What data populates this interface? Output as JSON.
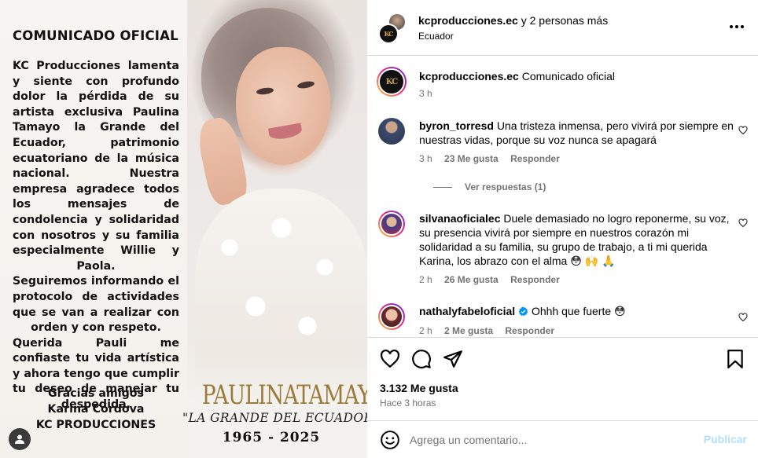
{
  "post_image": {
    "statement_title": "COMUNICADO OFICIAL",
    "statement_lead": "KC Producciones",
    "statement_p1_rest": " lamenta y siente con profundo dolor la pérdida de su artista exclusiva Paulina Tamayo la Grande del Ecuador, patrimonio ecuatoriano de la música nacional. Nuestra empresa agradece todos los mensajes de condolencia y solidaridad con nosotros y su familia especialmente Willie y Paola.",
    "statement_p2": "Seguiremos informando el protocolo de actividades que se van a realizar con orden y con respeto.",
    "statement_p3": "Querida Pauli me confiaste tu vida artística y ahora tengo que cumplir tu deseo de manejar tu despedida.",
    "signoff": [
      "Gracias amigos",
      "Karina Córdova",
      "KC PRODUCCIONES"
    ],
    "artist_name": "PAULINATAMAYO",
    "artist_tagline": "\"LA GRANDE DEL ECUADOR\"",
    "artist_years": "1965 - 2025"
  },
  "header": {
    "username": "kcproducciones.ec",
    "connector": " y 2 personas más",
    "location": "Ecuador",
    "logo_text": "KC"
  },
  "caption": {
    "username": "kcproducciones.ec",
    "text": "Comunicado oficial",
    "time": "3 h"
  },
  "comments": [
    {
      "username": "byron_torresd",
      "text": "Una tristeza inmensa, pero vivirá por siempre en nuestras vidas, porque su voz nunca se apagará",
      "time": "3 h",
      "likes": "23 Me gusta",
      "reply": "Responder",
      "replies_label": "Ver respuestas (1)",
      "verified": false
    },
    {
      "username": "silvanaoficialec",
      "text": "Duele demasiado no logro reponerme, su voz, su presencia vivirá por siempre en nuestros corazón mi solidaridad a su familia, su grupo de trabajo, a ti mi querida Karina, los abrazo con el alma 😳 🙌 🙏",
      "time": "2 h",
      "likes": "26 Me gusta",
      "reply": "Responder",
      "verified": false
    },
    {
      "username": "nathalyfabeloficial",
      "text": "Ohhh que fuerte 😳",
      "time": "2 h",
      "likes": "2 Me gusta",
      "reply": "Responder",
      "verified": true
    }
  ],
  "actions": {
    "likes_count": "3.132 Me gusta",
    "posted_ago": "Hace 3 horas"
  },
  "add_comment": {
    "placeholder": "Agrega un comentario...",
    "publish_label": "Publicar"
  },
  "colors": {
    "gold": "#9b7b3c",
    "verified": "#0095f6",
    "muted": "#737373",
    "publish_disabled": "#b2dffc"
  }
}
